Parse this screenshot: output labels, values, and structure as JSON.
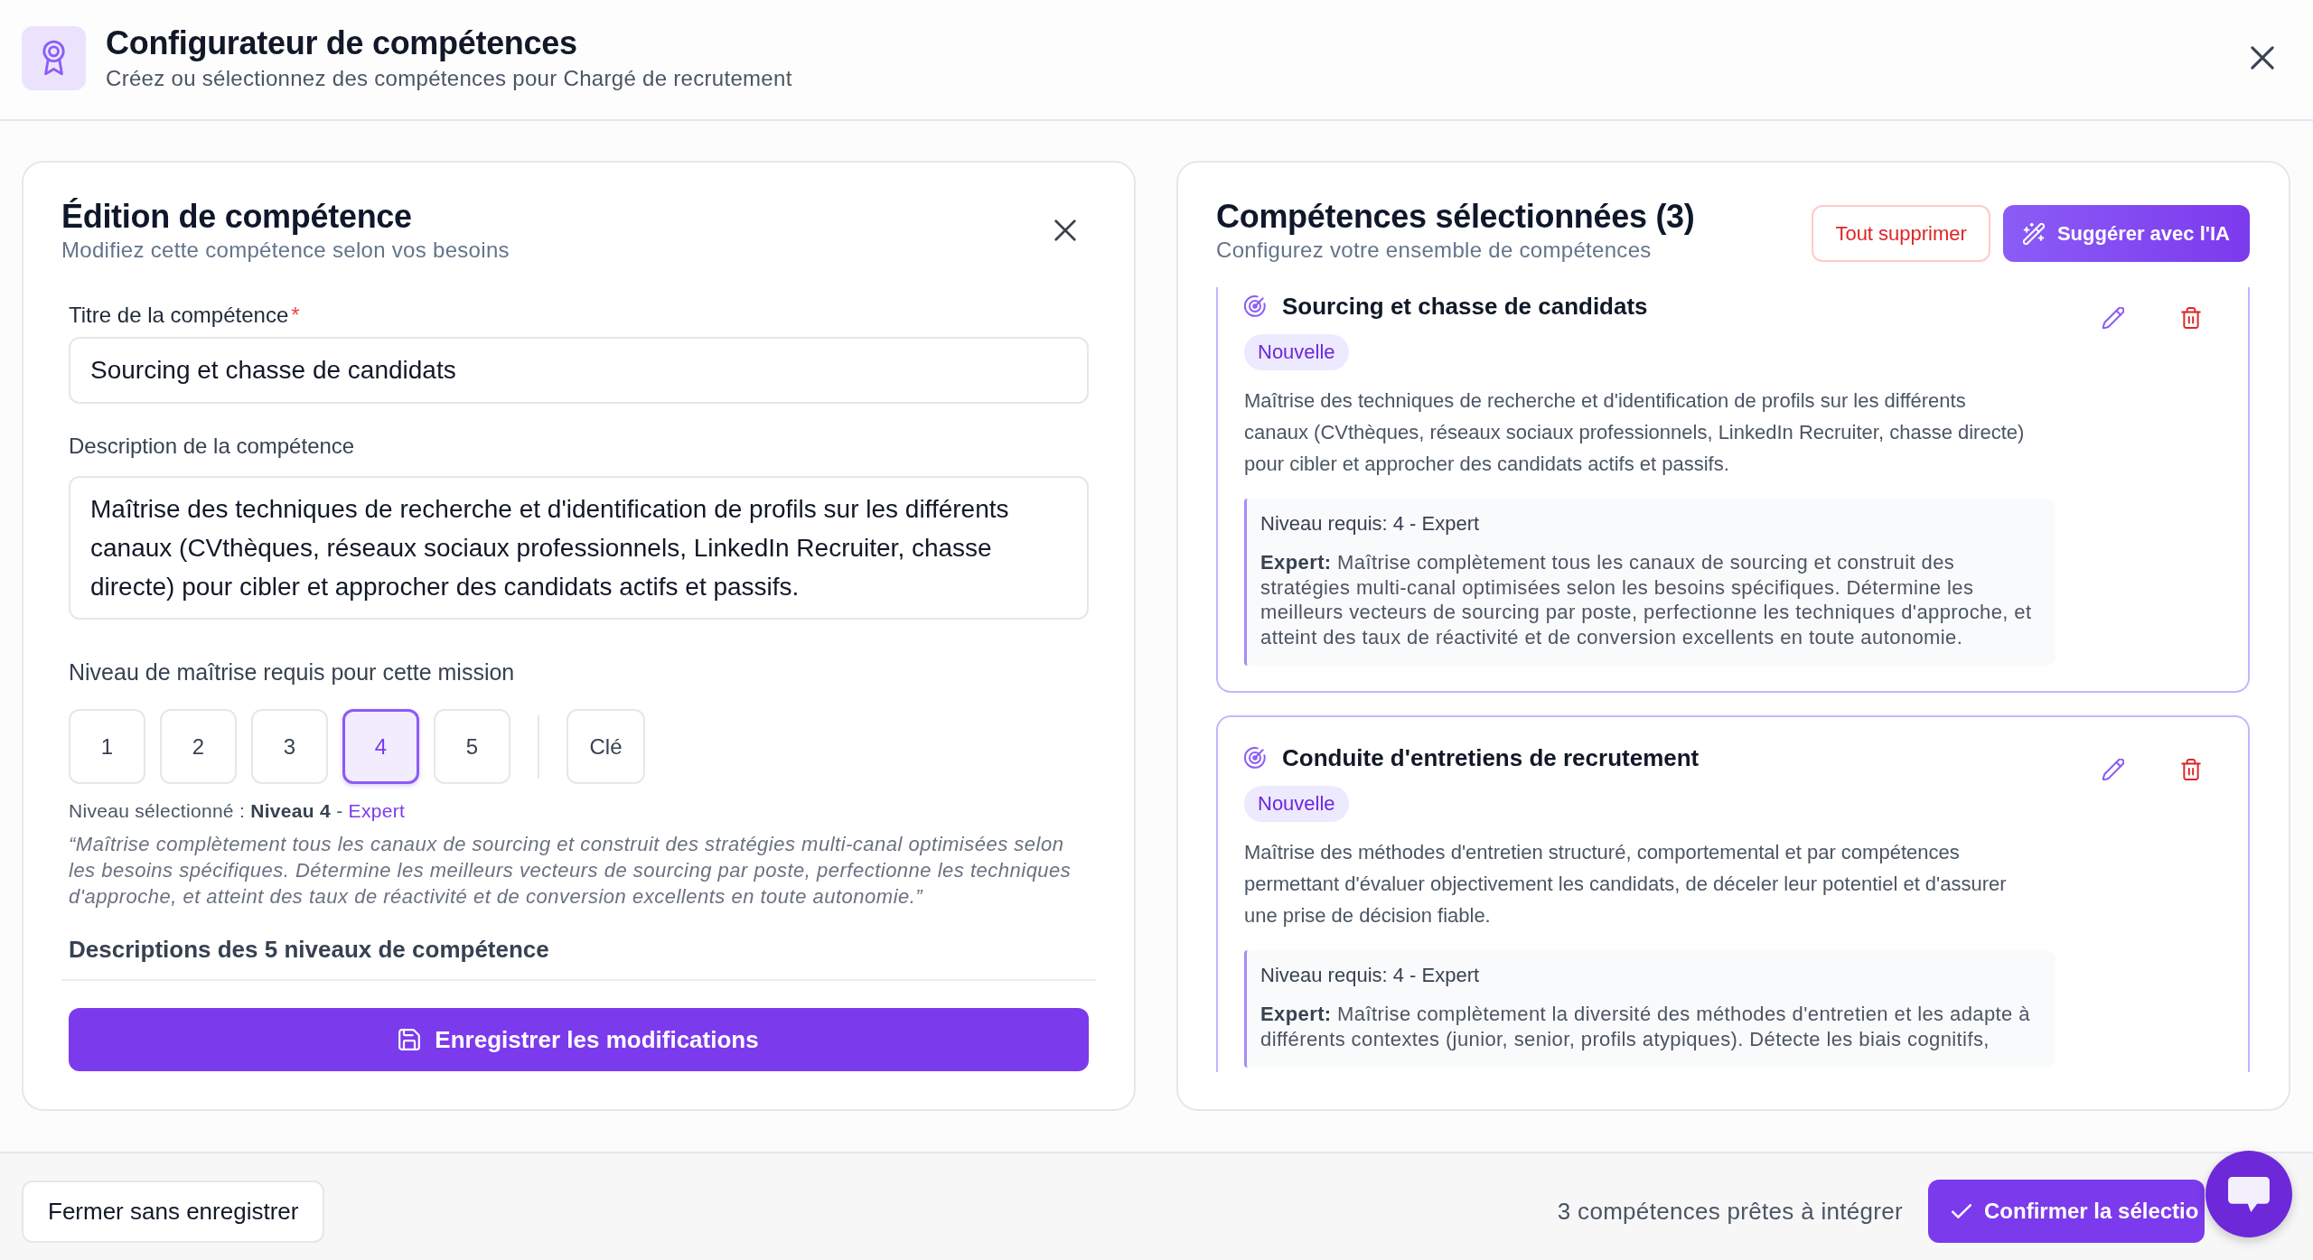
{
  "header": {
    "title": "Configurateur de compétences",
    "subtitle": "Créez ou sélectionnez des compétences pour Chargé de recrutement"
  },
  "editor": {
    "title": "Édition de compétence",
    "subtitle": "Modifiez cette compétence selon vos besoins",
    "title_field": {
      "label": "Titre de la compétence",
      "required_mark": "*",
      "value": "Sourcing et chasse de candidats"
    },
    "description_field": {
      "label": "Description de la compétence",
      "value": "Maîtrise des techniques de recherche et d'identification de profils sur les différents canaux (CVthèques, réseaux sociaux professionnels, LinkedIn Recruiter, chasse directe) pour cibler et approcher des candidats actifs et passifs."
    },
    "level_label": "Niveau de maîtrise requis pour cette mission",
    "levels": [
      {
        "label": "1",
        "kind": "level",
        "selected": false
      },
      {
        "label": "2",
        "kind": "level",
        "selected": false
      },
      {
        "label": "3",
        "kind": "level",
        "selected": false
      },
      {
        "label": "4",
        "kind": "level",
        "selected": true
      },
      {
        "label": "5",
        "kind": "level",
        "selected": false
      },
      {
        "label": "Clé",
        "kind": "key",
        "selected": false
      }
    ],
    "selection": {
      "text": "Niveau sélectionné : **Niveau 4** - ",
      "level_name": "Expert"
    },
    "quote": "“Maîtrise complètement tous les canaux de sourcing et construit des stratégies multi-canal optimisées selon les besoins spécifiques. Détermine les meilleurs vecteurs de sourcing par poste, perfectionne les techniques d'approche, et atteint des taux de réactivité et de conversion excellents en toute autonomie.”",
    "levels_heading": "Descriptions des 5 niveaux de compétence",
    "save_button": "Enregistrer les modifications"
  },
  "selected": {
    "title": "Compétences sélectionnées (3)",
    "subtitle": "Configurez votre ensemble de compétences",
    "clear_button": "Tout supprimer",
    "suggest_button": "Suggérer avec l'IA",
    "skills": [
      {
        "title": "Sourcing et chasse de candidats",
        "badge": "Nouvelle",
        "description": "Maîtrise des techniques de recherche et d'identification de profils sur les différents canaux (CVthèques, réseaux sociaux professionnels, LinkedIn Recruiter, chasse directe) pour cibler et approcher des candidats actifs et passifs.",
        "level_heading": "Niveau requis: 4 - Expert",
        "level_text": "**Expert:** Maîtrise complètement tous les canaux de sourcing et construit des stratégies multi-canal optimisées selon les besoins spécifiques. Détermine les meilleurs vecteurs de sourcing par poste, perfectionne les techniques d'approche, et atteint des taux de réactivité et de conversion excellents en toute autonomie."
      },
      {
        "title": "Conduite d'entretiens de recrutement",
        "badge": "Nouvelle",
        "description": "Maîtrise des méthodes d'entretien structuré, comportemental et par compétences permettant d'évaluer objectivement les candidats, de déceler leur potentiel et d'assurer une prise de décision fiable.",
        "level_heading": "Niveau requis: 4 - Expert",
        "level_text": "**Expert:** Maîtrise complètement la diversité des méthodes d'entretien et les adapte à différents contextes (junior, senior, profils atypiques). Détecte les biais cognitifs,"
      }
    ]
  },
  "footer": {
    "close_button": "Fermer sans enregistrer",
    "status": "3 compétences prêtes à intégrer",
    "confirm_button": "Confirmer la sélectio"
  }
}
